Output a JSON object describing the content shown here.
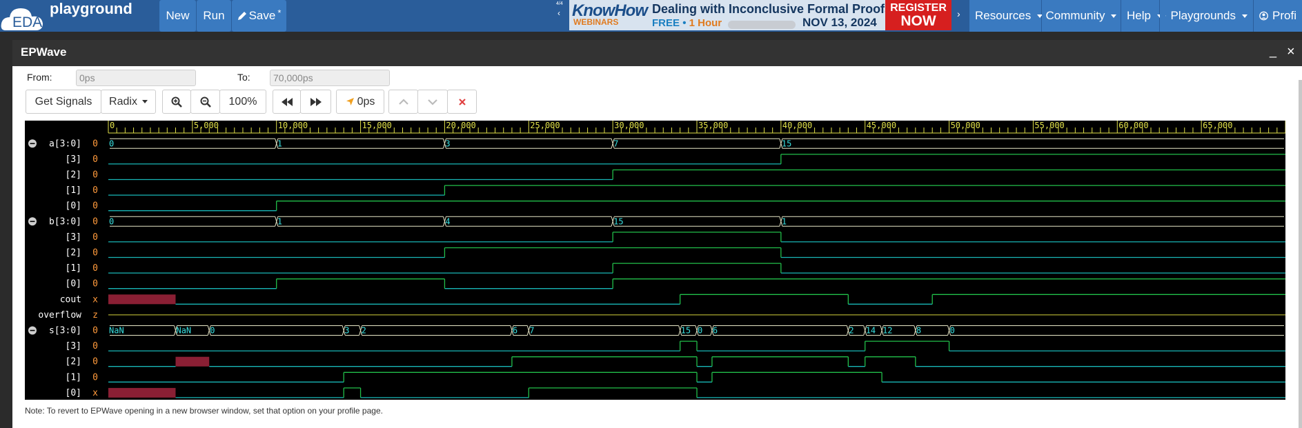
{
  "nav": {
    "logo_text": "EDA",
    "brand": "playground",
    "buttons": {
      "new": "New",
      "run": "Run",
      "save": "Save",
      "save_mark": "*"
    },
    "menus": {
      "resources": "Resources",
      "community": "Community",
      "help": "Help",
      "playgrounds": "Playgrounds",
      "profile": "Profi"
    }
  },
  "ad": {
    "counter": "4/4",
    "know": "KnowHow",
    "webinars": "WEBINARS",
    "title": "Dealing with Inconclusive Formal Proofs",
    "free": "FREE",
    "dot": "•",
    "duration": "1 Hour",
    "date": "NOV 13, 2024",
    "register_1": "REGISTER",
    "register_2": "NOW"
  },
  "window": {
    "title": "EPWave",
    "minimize": "_",
    "close": "×"
  },
  "range": {
    "from_label": "From:",
    "from_value": "0ps",
    "to_label": "To:",
    "to_value": "70,000ps"
  },
  "toolbar": {
    "get_signals": "Get Signals",
    "radix": "Radix",
    "zoom": "100%",
    "cursor": "0ps"
  },
  "note": "Note: To revert to EPWave opening in a new browser window, set that option on your profile page.",
  "colors": {
    "bus": "#e8e8c8",
    "high": "#22c04a",
    "low": "#19b7b7",
    "unknown": "#8a1f34",
    "z": "#d6d23c",
    "time_axis": "#e0e04a",
    "label": "#ffffff",
    "value": "#ff9a3c"
  },
  "waveform": {
    "time_end": 70000,
    "ticks": [
      "0",
      "5,000",
      "10,000",
      "15,000",
      "20,000",
      "25,000",
      "30,000",
      "35,000",
      "40,000",
      "45,000",
      "50,000",
      "55,000",
      "60,000",
      "65,000"
    ],
    "signals": [
      {
        "name": "a[3:0]",
        "value": "0",
        "kind": "bus",
        "collapse": true,
        "segments": [
          [
            0,
            10000,
            "0"
          ],
          [
            10000,
            20000,
            "1"
          ],
          [
            20000,
            30000,
            "3"
          ],
          [
            30000,
            40000,
            "7"
          ],
          [
            40000,
            70000,
            "15"
          ]
        ]
      },
      {
        "name": "[3]",
        "value": "0",
        "kind": "bit",
        "segments": [
          [
            0,
            40000,
            "0"
          ],
          [
            40000,
            70000,
            "1"
          ]
        ]
      },
      {
        "name": "[2]",
        "value": "0",
        "kind": "bit",
        "segments": [
          [
            0,
            30000,
            "0"
          ],
          [
            30000,
            70000,
            "1"
          ]
        ]
      },
      {
        "name": "[1]",
        "value": "0",
        "kind": "bit",
        "segments": [
          [
            0,
            20000,
            "0"
          ],
          [
            20000,
            70000,
            "1"
          ]
        ]
      },
      {
        "name": "[0]",
        "value": "0",
        "kind": "bit",
        "segments": [
          [
            0,
            10000,
            "0"
          ],
          [
            10000,
            70000,
            "1"
          ]
        ]
      },
      {
        "name": "b[3:0]",
        "value": "0",
        "kind": "bus",
        "collapse": true,
        "segments": [
          [
            0,
            10000,
            "0"
          ],
          [
            10000,
            20000,
            "1"
          ],
          [
            20000,
            30000,
            "4"
          ],
          [
            30000,
            40000,
            "15"
          ],
          [
            40000,
            70000,
            "1"
          ]
        ]
      },
      {
        "name": "[3]",
        "value": "0",
        "kind": "bit",
        "segments": [
          [
            0,
            30000,
            "0"
          ],
          [
            30000,
            40000,
            "1"
          ],
          [
            40000,
            70000,
            "0"
          ]
        ]
      },
      {
        "name": "[2]",
        "value": "0",
        "kind": "bit",
        "segments": [
          [
            0,
            20000,
            "0"
          ],
          [
            20000,
            40000,
            "1"
          ],
          [
            40000,
            70000,
            "0"
          ]
        ]
      },
      {
        "name": "[1]",
        "value": "0",
        "kind": "bit",
        "segments": [
          [
            0,
            30000,
            "0"
          ],
          [
            30000,
            40000,
            "1"
          ],
          [
            40000,
            70000,
            "0"
          ]
        ]
      },
      {
        "name": "[0]",
        "value": "0",
        "kind": "bit",
        "segments": [
          [
            0,
            10000,
            "0"
          ],
          [
            10000,
            20000,
            "1"
          ],
          [
            20000,
            30000,
            "0"
          ],
          [
            30000,
            70000,
            "1"
          ]
        ]
      },
      {
        "name": "cout",
        "value": "x",
        "kind": "bit",
        "segments": [
          [
            0,
            4000,
            "x"
          ],
          [
            4000,
            34000,
            "0"
          ],
          [
            34000,
            44000,
            "1"
          ],
          [
            44000,
            49000,
            "0"
          ],
          [
            49000,
            70000,
            "1"
          ]
        ]
      },
      {
        "name": "overflow",
        "value": "z",
        "kind": "bit",
        "segments": [
          [
            0,
            70000,
            "z"
          ]
        ]
      },
      {
        "name": "s[3:0]",
        "value": "0",
        "kind": "bus",
        "collapse": true,
        "segments": [
          [
            0,
            4000,
            "NaN"
          ],
          [
            4000,
            6000,
            "NaN"
          ],
          [
            6000,
            14000,
            "0"
          ],
          [
            14000,
            15000,
            "3"
          ],
          [
            15000,
            24000,
            "2"
          ],
          [
            24000,
            25000,
            "6"
          ],
          [
            25000,
            34000,
            "7"
          ],
          [
            34000,
            35000,
            "15"
          ],
          [
            35000,
            35900,
            "0"
          ],
          [
            35900,
            44000,
            "6"
          ],
          [
            44000,
            45000,
            "2"
          ],
          [
            45000,
            46000,
            "14"
          ],
          [
            46000,
            48000,
            "12"
          ],
          [
            48000,
            50000,
            "8"
          ],
          [
            50000,
            70000,
            "0"
          ]
        ]
      },
      {
        "name": "[3]",
        "value": "0",
        "kind": "bit",
        "segments": [
          [
            0,
            34000,
            "0"
          ],
          [
            34000,
            35000,
            "1"
          ],
          [
            35000,
            45000,
            "0"
          ],
          [
            45000,
            50000,
            "1"
          ],
          [
            50000,
            70000,
            "0"
          ]
        ]
      },
      {
        "name": "[2]",
        "value": "0",
        "kind": "bit",
        "segments": [
          [
            0,
            4000,
            "0"
          ],
          [
            4000,
            6000,
            "x"
          ],
          [
            6000,
            24000,
            "0"
          ],
          [
            24000,
            35000,
            "1"
          ],
          [
            35000,
            35900,
            "0"
          ],
          [
            35900,
            44000,
            "1"
          ],
          [
            44000,
            45000,
            "0"
          ],
          [
            45000,
            48000,
            "1"
          ],
          [
            48000,
            70000,
            "0"
          ]
        ]
      },
      {
        "name": "[1]",
        "value": "0",
        "kind": "bit",
        "segments": [
          [
            0,
            14000,
            "0"
          ],
          [
            14000,
            35000,
            "1"
          ],
          [
            35000,
            35900,
            "0"
          ],
          [
            35900,
            46000,
            "1"
          ],
          [
            46000,
            70000,
            "0"
          ]
        ]
      },
      {
        "name": "[0]",
        "value": "x",
        "kind": "bit",
        "segments": [
          [
            0,
            4000,
            "x"
          ],
          [
            4000,
            14000,
            "0"
          ],
          [
            14000,
            15000,
            "1"
          ],
          [
            15000,
            25000,
            "0"
          ],
          [
            25000,
            35000,
            "1"
          ],
          [
            35000,
            70000,
            "0"
          ]
        ]
      }
    ]
  }
}
